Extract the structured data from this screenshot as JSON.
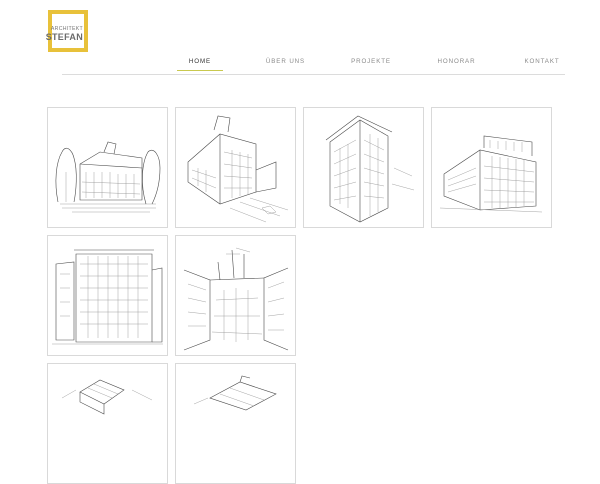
{
  "logo": {
    "top_text": "ARCHITEKT",
    "bottom_text": "STEFAN",
    "accent": "#e8c13a"
  },
  "nav": {
    "active_accent": "#c9c94f",
    "items": [
      {
        "label": "HOME",
        "active": true
      },
      {
        "label": "ÜBER UNS",
        "active": false
      },
      {
        "label": "PROJEKTE",
        "active": false
      },
      {
        "label": "HONORAR",
        "active": false
      },
      {
        "label": "KONTAKT",
        "active": false
      }
    ]
  },
  "gallery": {
    "items": [
      {
        "subject": "house-with-trees-sketch"
      },
      {
        "subject": "villa-perspective-sketch"
      },
      {
        "subject": "corner-building-sketch"
      },
      {
        "subject": "modern-building-sketch"
      },
      {
        "subject": "apartment-facade-sketch"
      },
      {
        "subject": "street-view-sketch"
      },
      {
        "subject": "aerial-block-sketch"
      },
      {
        "subject": "rooftop-sketch"
      }
    ]
  }
}
